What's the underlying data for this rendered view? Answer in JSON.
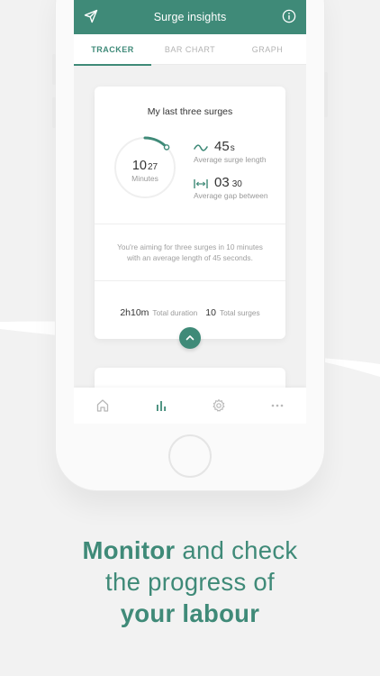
{
  "header": {
    "title": "Surge insights",
    "send_icon": "send-icon",
    "info_icon": "info-icon"
  },
  "tabs": [
    {
      "label": "TRACKER",
      "active": true
    },
    {
      "label": "BAR CHART",
      "active": false
    },
    {
      "label": "GRAPH",
      "active": false
    }
  ],
  "card": {
    "title": "My last three surges",
    "ring": {
      "value_main": "10",
      "value_small": "27",
      "label": "Minutes",
      "progress_fraction": 0.13
    },
    "surge_length": {
      "value": "45",
      "unit": "s",
      "label": "Average surge length",
      "icon": "wave-icon"
    },
    "gap": {
      "value": "03",
      "value_small": "30",
      "label": "Average gap between",
      "icon": "interval-icon"
    },
    "goal_line1": "You're aiming for three surges in 10 minutes",
    "goal_line2": "with an average length of 45 seconds.",
    "total_duration": {
      "value": "2h10m",
      "label": "Total duration"
    },
    "total_surges": {
      "value": "10",
      "label": "Total surges"
    }
  },
  "bottom_nav": [
    {
      "name": "home",
      "icon": "home-icon",
      "active": false
    },
    {
      "name": "insights",
      "icon": "bar-chart-icon",
      "active": true
    },
    {
      "name": "settings",
      "icon": "gear-icon",
      "active": false
    },
    {
      "name": "more",
      "icon": "more-icon",
      "active": false
    }
  ],
  "headline": {
    "line1_bold": "Monitor",
    "line1_rest": " and check",
    "line2": "the progress of",
    "line3_bold": "your labour"
  },
  "colors": {
    "accent": "#3f8a78",
    "background": "#f2f2f2",
    "card": "#ffffff"
  }
}
